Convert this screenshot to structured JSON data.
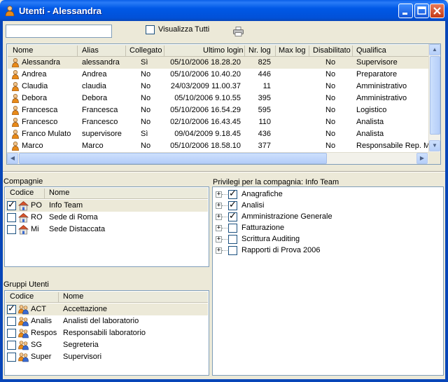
{
  "window": {
    "title": "Utenti - Alessandra",
    "buttons": [
      "minimize",
      "maximize",
      "close"
    ]
  },
  "toolbar": {
    "search_value": "",
    "show_all_label": "Visualizza Tutti",
    "show_all_checked": false,
    "print_icon": "printer-icon"
  },
  "users": {
    "columns": [
      "Nome",
      "Alias",
      "Collegato",
      "Ultimo login",
      "Nr. log",
      "Max log",
      "Disabilitato",
      "Qualifica"
    ],
    "rows": [
      {
        "nome": "Alessandra",
        "alias": "alessandra",
        "collegato": "Sì",
        "login": "05/10/2006 18.28.20",
        "nrlog": "825",
        "maxlog": "",
        "disab": "No",
        "qual": "Supervisore"
      },
      {
        "nome": "Andrea",
        "alias": "Andrea",
        "collegato": "No",
        "login": "05/10/2006 10.40.20",
        "nrlog": "446",
        "maxlog": "",
        "disab": "No",
        "qual": "Preparatore"
      },
      {
        "nome": "Claudia",
        "alias": "claudia",
        "collegato": "No",
        "login": "24/03/2009 11.00.37",
        "nrlog": "11",
        "maxlog": "",
        "disab": "No",
        "qual": "Amministrativo"
      },
      {
        "nome": "Debora",
        "alias": "Debora",
        "collegato": "No",
        "login": "05/10/2006 9.10.55",
        "nrlog": "395",
        "maxlog": "",
        "disab": "No",
        "qual": "Amministrativo"
      },
      {
        "nome": "Francesca",
        "alias": "Francesca",
        "collegato": "No",
        "login": "05/10/2006 16.54.29",
        "nrlog": "595",
        "maxlog": "",
        "disab": "No",
        "qual": "Logistico"
      },
      {
        "nome": "Francesco",
        "alias": "Francesco",
        "collegato": "No",
        "login": "02/10/2006 16.43.45",
        "nrlog": "110",
        "maxlog": "",
        "disab": "No",
        "qual": "Analista"
      },
      {
        "nome": "Franco Mulato",
        "alias": "supervisore",
        "collegato": "Sì",
        "login": "09/04/2009 9.18.45",
        "nrlog": "436",
        "maxlog": "",
        "disab": "No",
        "qual": "Analista"
      },
      {
        "nome": "Marco",
        "alias": "Marco",
        "collegato": "No",
        "login": "05/10/2006 18.58.10",
        "nrlog": "377",
        "maxlog": "",
        "disab": "No",
        "qual": "Responsabile Rep. M"
      }
    ],
    "selected_index": 0
  },
  "companies": {
    "label": "Compagnie",
    "columns": [
      "Codice",
      "Nome"
    ],
    "rows": [
      {
        "codice": "PO",
        "nome": "Info Team",
        "checked": true
      },
      {
        "codice": "RO",
        "nome": "Sede di Roma",
        "checked": false
      },
      {
        "codice": "Mi",
        "nome": "Sede Distaccata",
        "checked": false
      }
    ],
    "selected_index": 0
  },
  "groups": {
    "label": "Gruppi Utenti",
    "columns": [
      "Codice",
      "Nome"
    ],
    "rows": [
      {
        "codice": "ACT",
        "nome": "Accettazione",
        "checked": true
      },
      {
        "codice": "Analis",
        "nome": "Analisti del laboratorio",
        "checked": false
      },
      {
        "codice": "Respos",
        "nome": "Responsabili laboratorio",
        "checked": false
      },
      {
        "codice": "SG",
        "nome": "Segreteria",
        "checked": false
      },
      {
        "codice": "Super",
        "nome": "Supervisori",
        "checked": false
      }
    ],
    "selected_index": 0
  },
  "privileges": {
    "label": "Privilegi per la compagnia: Info Team",
    "items": [
      {
        "label": "Anagrafiche",
        "checked": true
      },
      {
        "label": "Analisi",
        "checked": true
      },
      {
        "label": "Amministrazione Generale",
        "checked": true
      },
      {
        "label": "Fatturazione",
        "checked": false
      },
      {
        "label": "Scrittura Auditing",
        "checked": false
      },
      {
        "label": "Rapporti di Prova 2006",
        "checked": false
      }
    ]
  },
  "colors": {
    "titlebar": "#0058e6",
    "window_bg": "#ece9d8",
    "selection": "#ece9d8",
    "border": "#7f9db9"
  }
}
